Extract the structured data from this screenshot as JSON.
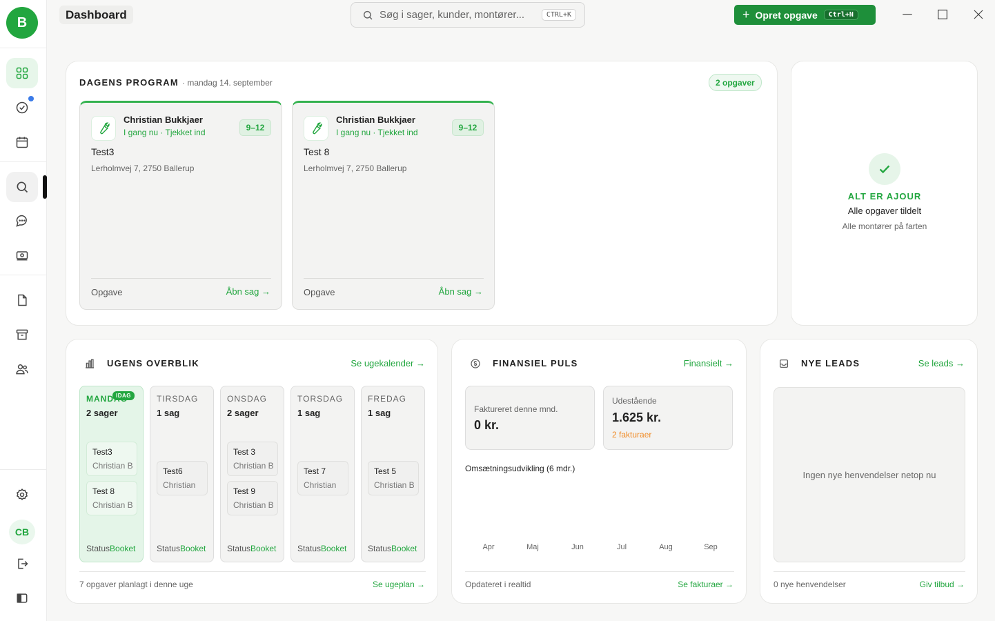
{
  "sidebar": {
    "logo": "B",
    "user_initials": "CB"
  },
  "header": {
    "title": "Dashboard",
    "search_placeholder": "Søg i sager, kunder, montører...",
    "search_shortcut": "CTRL+K",
    "create_label": "Opret opgave",
    "create_shortcut": "Ctrl+N"
  },
  "program": {
    "title": "DAGENS PROGRAM",
    "date": "· mandag 14. september",
    "count": "2 opgaver",
    "jobs": [
      {
        "technician": "Christian Bukkjaer",
        "status": "I gang nu · Tjekket ind",
        "time": "9–12",
        "title": "Test3",
        "address": "Lerholmvej 7, 2750 Ballerup",
        "type": "Opgave",
        "open": "Åbn sag →"
      },
      {
        "technician": "Christian Bukkjaer",
        "status": "I gang nu · Tjekket ind",
        "time": "9–12",
        "title": "Test 8",
        "address": "Lerholmvej 7, 2750 Ballerup",
        "type": "Opgave",
        "open": "Åbn sag →"
      }
    ]
  },
  "status_panel": {
    "title": "ALT ER AJOUR",
    "line1": "Alle opgaver tildelt",
    "line2": "Alle montører på farten"
  },
  "week": {
    "title": "UGENS OVERBLIK",
    "link": "Se ugekalender →",
    "today_badge": "IDAG",
    "status_label": "Status",
    "status_value": "Booket",
    "days": [
      {
        "name": "MANDAG",
        "count": "2 sager",
        "events": [
          {
            "title": "Test3",
            "person": "Christian B"
          },
          {
            "title": "Test 8",
            "person": "Christian B"
          }
        ]
      },
      {
        "name": "TIRSDAG",
        "count": "1 sag",
        "events": [
          {
            "title": "Test6",
            "person": "Christian"
          }
        ]
      },
      {
        "name": "ONSDAG",
        "count": "2 sager",
        "events": [
          {
            "title": "Test 3",
            "person": "Christian B"
          },
          {
            "title": "Test 9",
            "person": "Christian B"
          }
        ]
      },
      {
        "name": "TORSDAG",
        "count": "1 sag",
        "events": [
          {
            "title": "Test 7",
            "person": "Christian"
          }
        ]
      },
      {
        "name": "FREDAG",
        "count": "1 sag",
        "events": [
          {
            "title": "Test 5",
            "person": "Christian B"
          }
        ]
      }
    ],
    "footer": "7 opgaver planlagt i denne uge",
    "footer_link": "Se ugeplan →"
  },
  "finance": {
    "title": "FINANSIEL PULS",
    "link": "Finansielt →",
    "invoiced_label": "Faktureret denne mnd.",
    "invoiced_value": "0 kr.",
    "outstanding_label": "Udestående",
    "outstanding_value": "1.625 kr.",
    "outstanding_sub": "2 fakturaer",
    "chart_title": "Omsætningsudvikling (6 mdr.)",
    "months": [
      "Apr",
      "Maj",
      "Jun",
      "Jul",
      "Aug",
      "Sep"
    ],
    "footer": "Opdateret i realtid",
    "footer_link": "Se fakturaer →"
  },
  "leads": {
    "title": "NYE LEADS",
    "link": "Se leads →",
    "empty": "Ingen nye henvendelser netop nu",
    "footer": "0 nye henvendelser",
    "footer_link": "Giv tilbud →"
  },
  "colors": {
    "accent": "#22a63f",
    "button": "#1e8f3a",
    "warning": "#f08a24",
    "notification": "#3b7be8"
  }
}
